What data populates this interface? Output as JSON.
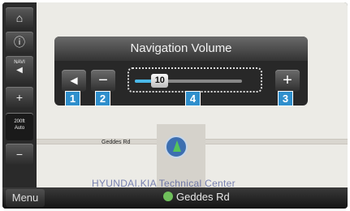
{
  "map": {
    "road_name": "Geddes Rd",
    "poi": "HYUNDAI.KIA Technical Center"
  },
  "sidebar": {
    "home": "⌂",
    "compass": "ⓘ",
    "navi_label": "NAVI",
    "navi_icon": "◀",
    "zoom_in": "+",
    "zoom_value": "200ft",
    "zoom_mode": "Auto",
    "zoom_out": "−"
  },
  "bottom_bar": {
    "menu_label": "Menu",
    "road_name": "Geddes Rd"
  },
  "volume_panel": {
    "title": "Navigation Volume",
    "mute_icon": "◀",
    "minus_label": "−",
    "plus_label": "+",
    "value": "10",
    "level_fraction": 0.26
  },
  "callouts": [
    "1",
    "2",
    "3",
    "4"
  ],
  "colors": {
    "accent": "#4ab8e8",
    "callout": "#2f8fcc"
  }
}
